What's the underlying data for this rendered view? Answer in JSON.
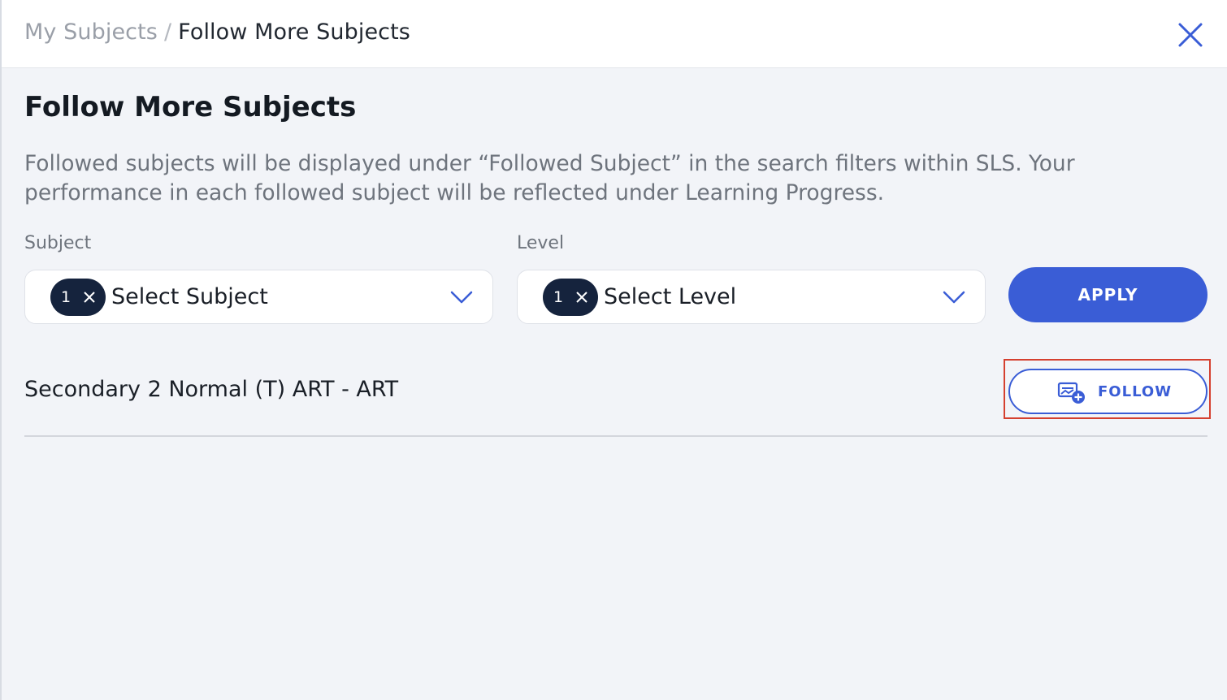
{
  "breadcrumb": {
    "parent": "My Subjects",
    "separator": "/",
    "current": "Follow More Subjects"
  },
  "page": {
    "title": "Follow More Subjects",
    "description": "Followed subjects will be displayed under “Followed Subject” in the search filters within SLS. Your performance in each followed subject will be reflected under Learning Progress."
  },
  "filters": {
    "subject": {
      "label": "Subject",
      "chip_count": "1",
      "placeholder": "Select Subject"
    },
    "level": {
      "label": "Level",
      "chip_count": "1",
      "placeholder": "Select Level"
    },
    "apply_label": "APPLY"
  },
  "results": [
    {
      "name": "Secondary 2 Normal (T) ART - ART",
      "follow_label": "FOLLOW"
    }
  ],
  "icons": {
    "close": "close-icon",
    "chip_remove": "x-icon",
    "dropdown": "chevron-down-icon",
    "follow": "follow-subject-icon"
  },
  "colors": {
    "primary": "#3a5dd6",
    "chip_bg": "#15233d",
    "highlight": "#d5402f",
    "background": "#f2f4f8"
  }
}
